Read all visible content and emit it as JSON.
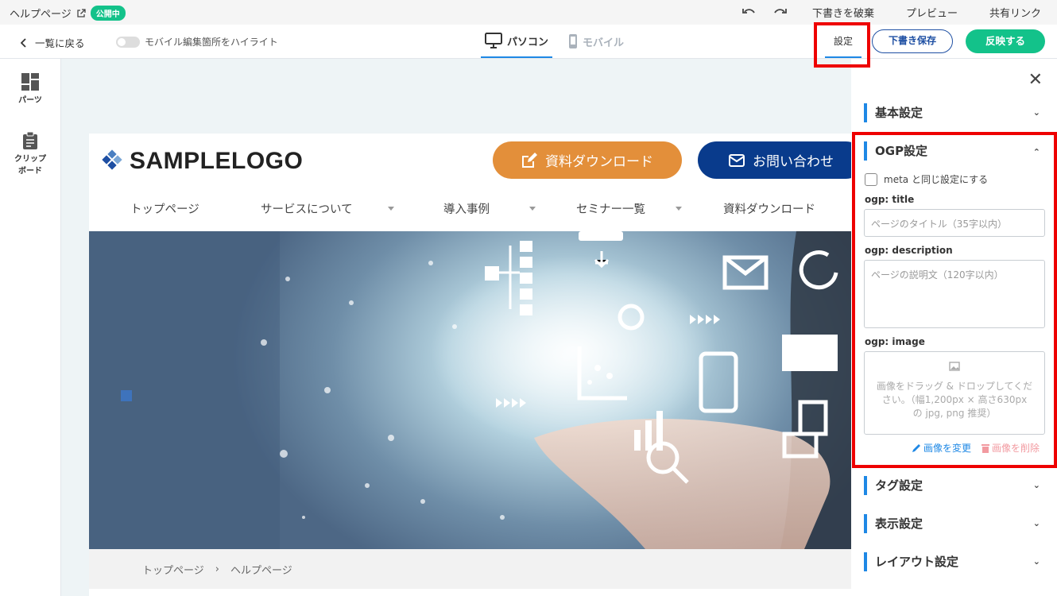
{
  "topbar": {
    "page_title": "ヘルプページ",
    "status_badge": "公開中",
    "draft_discard": "下書きを破棄",
    "preview": "プレビュー",
    "share_link": "共有リンク"
  },
  "toolbar": {
    "back": "一覧に戻る",
    "highlight_toggle": "モバイル編集箇所をハイライト",
    "device_pc": "パソコン",
    "device_mobile": "モバイル",
    "settings_tab": "設定",
    "save_draft": "下書き保存",
    "apply": "反映する"
  },
  "left_sidebar": {
    "parts": "パーツ",
    "clipboard_1": "クリップ",
    "clipboard_2": "ボード"
  },
  "preview": {
    "logo": "SAMPLELOGO",
    "btn_download": "資料ダウンロード",
    "btn_contact": "お問い合わせ",
    "nav": [
      "トップページ",
      "サービスについて",
      "導入事例",
      "セミナー一覧",
      "資料ダウンロード"
    ],
    "breadcrumb": [
      "トップページ",
      "ヘルプページ"
    ],
    "breadcrumb_sep": "›"
  },
  "panel": {
    "basic": "基本設定",
    "ogp": "OGP設定",
    "same_as_meta": "meta と同じ設定にする",
    "ogp_title_label": "ogp: title",
    "ogp_title_placeholder": "ページのタイトル（35字以内）",
    "ogp_desc_label": "ogp: description",
    "ogp_desc_placeholder": "ページの説明文（120字以内）",
    "ogp_image_label": "ogp: image",
    "image_drop": "画像をドラッグ & ドロップしてください。（幅1,200px × 高さ630px の jpg, png 推奨）",
    "change_image": "画像を変更",
    "delete_image": "画像を削除",
    "tag": "タグ設定",
    "display": "表示設定",
    "layout": "レイアウト設定"
  },
  "colors": {
    "accent_green": "#13c28a",
    "accent_blue": "#1e88e5",
    "navy": "#093b8c",
    "orange": "#e38f3a",
    "highlight_red": "#ee0000"
  }
}
